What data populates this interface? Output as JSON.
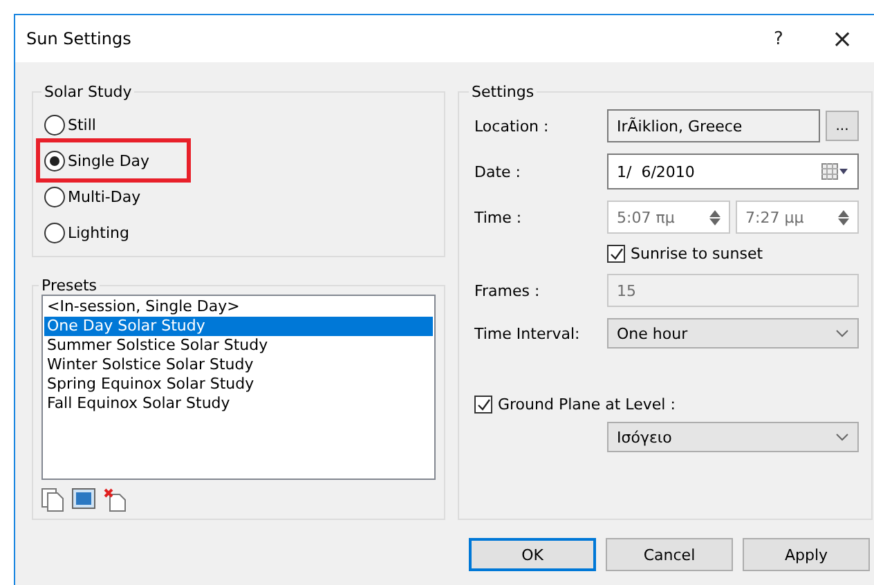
{
  "window": {
    "title": "Sun Settings",
    "help": "?",
    "close": "×"
  },
  "solar_study": {
    "title": "Solar Study",
    "options": [
      {
        "label": "Still",
        "selected": false,
        "highlighted": false
      },
      {
        "label": "Single Day",
        "selected": true,
        "highlighted": true
      },
      {
        "label": "Multi-Day",
        "selected": false,
        "highlighted": false
      },
      {
        "label": "Lighting",
        "selected": false,
        "highlighted": false
      }
    ]
  },
  "presets": {
    "title": "Presets",
    "items": [
      {
        "label": "<In-session, Single Day>",
        "selected": false
      },
      {
        "label": "One Day Solar Study",
        "selected": true
      },
      {
        "label": "Summer Solstice Solar Study",
        "selected": false
      },
      {
        "label": "Winter Solstice Solar Study",
        "selected": false
      },
      {
        "label": "Spring Equinox Solar Study",
        "selected": false
      },
      {
        "label": "Fall Equinox Solar Study",
        "selected": false
      }
    ]
  },
  "settings": {
    "title": "Settings",
    "location": {
      "label": "Location :",
      "value": "IrÃiklion, Greece",
      "browse": "..."
    },
    "date": {
      "label": "Date :",
      "value": "1/  6/2010"
    },
    "time": {
      "label": "Time :",
      "start": "5:07 πμ",
      "end": "7:27 μμ",
      "disabled": true
    },
    "sunrise": {
      "label": "Sunrise to sunset",
      "checked": true
    },
    "frames": {
      "label": "Frames :",
      "value": "15",
      "disabled": true
    },
    "interval": {
      "label": "Time Interval:",
      "value": "One hour"
    },
    "ground": {
      "label": "Ground Plane at Level :",
      "checked": true,
      "value": "Ισόγειο"
    }
  },
  "buttons": [
    {
      "label": "OK",
      "default": true
    },
    {
      "label": "Cancel",
      "default": false
    },
    {
      "label": "Apply",
      "default": false
    }
  ]
}
